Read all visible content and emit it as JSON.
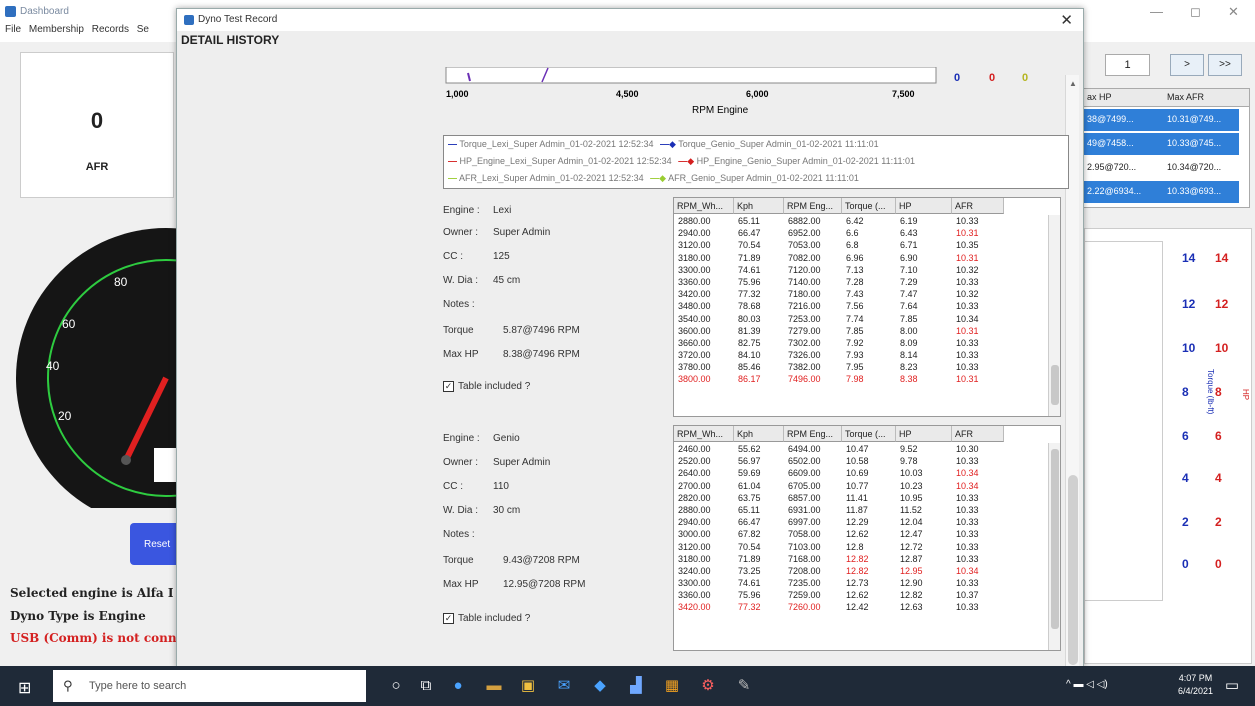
{
  "dashboard": {
    "title": "Dashboard",
    "menu": [
      "File",
      "Membership",
      "Records",
      "Se"
    ],
    "afr_value": "0",
    "afr_label": "AFR",
    "gauge_ticks": [
      "20",
      "40",
      "60",
      "80"
    ],
    "reset_label": "Reset",
    "status_lines": [
      {
        "text": "Selected engine is Alfa I",
        "color": "#1a1a6e"
      },
      {
        "text": "Dyno Type is Engine",
        "color": "#1a1a6e"
      },
      {
        "text": "USB (Comm) is not conn",
        "color": "#d42020"
      }
    ],
    "page_number": "1",
    "next_label": ">",
    "last_label": ">>",
    "max_table": {
      "headers": [
        "ax HP",
        "Max AFR"
      ],
      "rows": [
        {
          "hp": "38@7499...",
          "afr": "10.31@749..."
        },
        {
          "hp": "49@7458...",
          "afr": "10.33@745..."
        },
        {
          "hp": "2.95@720...",
          "afr": "10.34@720..."
        },
        {
          "hp": "2.22@6934...",
          "afr": "10.33@693..."
        }
      ]
    },
    "right_axis_blue": [
      "14",
      "12",
      "10",
      "8",
      "6",
      "4",
      "2",
      "0"
    ],
    "right_axis_red": [
      "14",
      "12",
      "10",
      "8",
      "6",
      "4",
      "2",
      "0"
    ],
    "right_axis_label_blue": "Torque (lb-ft)",
    "right_axis_label_red": "HP"
  },
  "dialog": {
    "title": "Dyno Test Record",
    "heading": "DETAIL HISTORY",
    "close_label": "✕"
  },
  "chart_data": {
    "type": "line",
    "x_ticks": [
      "1,000",
      "4,500",
      "6,000",
      "7,500"
    ],
    "xlabel": "RPM Engine",
    "ylabel": "",
    "readouts": [
      {
        "value": "0",
        "color": "#1a2fb5"
      },
      {
        "value": "0",
        "color": "#d42020"
      },
      {
        "value": "0",
        "color": "#b5b520"
      }
    ],
    "series": [
      {
        "name": "Torque_Lexi_Super Admin_01-02-2021 12:52:34",
        "color": "#1a2fb5"
      },
      {
        "name": "Torque_Genio_Super Admin_01-02-2021 11:11:01",
        "color": "#1a2fb5"
      },
      {
        "name": "HP_Engine_Lexi_Super Admin_01-02-2021 12:52:34",
        "color": "#d42020"
      },
      {
        "name": "HP_Engine_Genio_Super Admin_01-02-2021 11:11:01",
        "color": "#d42020"
      },
      {
        "name": "AFR_Lexi_Super Admin_01-02-2021 12:52:34",
        "color": "#9acd32"
      },
      {
        "name": "AFR_Genio_Super Admin_01-02-2021 11:11:01",
        "color": "#9acd32"
      }
    ]
  },
  "record1": {
    "engine_label": "Engine :",
    "engine": "Lexi",
    "owner_label": "Owner :",
    "owner": "Super Admin",
    "cc_label": "CC :",
    "cc": "125",
    "wdia_label": "W. Dia :",
    "wdia": "45 cm",
    "notes_label": "Notes :",
    "torque_label": "Torque",
    "torque": "5.87@7496 RPM",
    "maxhp_label": "Max HP",
    "maxhp": "8.38@7496 RPM",
    "table_included": "Table included ?",
    "headers": [
      "RPM_Wh...",
      "Kph",
      "RPM Eng...",
      "Torque (...",
      "HP",
      "AFR"
    ],
    "rows": [
      [
        "2880.00",
        "65.11",
        "6882.00",
        "6.42",
        "6.19",
        "10.33"
      ],
      [
        "2940.00",
        "66.47",
        "6952.00",
        "6.6",
        "6.43",
        "10.31"
      ],
      [
        "3120.00",
        "70.54",
        "7053.00",
        "6.8",
        "6.71",
        "10.35"
      ],
      [
        "3180.00",
        "71.89",
        "7082.00",
        "6.96",
        "6.90",
        "10.31"
      ],
      [
        "3300.00",
        "74.61",
        "7120.00",
        "7.13",
        "7.10",
        "10.32"
      ],
      [
        "3360.00",
        "75.96",
        "7140.00",
        "7.28",
        "7.29",
        "10.33"
      ],
      [
        "3420.00",
        "77.32",
        "7180.00",
        "7.43",
        "7.47",
        "10.32"
      ],
      [
        "3480.00",
        "78.68",
        "7216.00",
        "7.56",
        "7.64",
        "10.33"
      ],
      [
        "3540.00",
        "80.03",
        "7253.00",
        "7.74",
        "7.85",
        "10.34"
      ],
      [
        "3600.00",
        "81.39",
        "7279.00",
        "7.85",
        "8.00",
        "10.31"
      ],
      [
        "3660.00",
        "82.75",
        "7302.00",
        "7.92",
        "8.09",
        "10.33"
      ],
      [
        "3720.00",
        "84.10",
        "7326.00",
        "7.93",
        "8.14",
        "10.33"
      ],
      [
        "3780.00",
        "85.46",
        "7382.00",
        "7.95",
        "8.23",
        "10.33"
      ],
      [
        "3800.00",
        "86.17",
        "7496.00",
        "7.98",
        "8.38",
        "10.31"
      ]
    ]
  },
  "record2": {
    "engine_label": "Engine :",
    "engine": "Genio",
    "owner_label": "Owner :",
    "owner": "Super Admin",
    "cc_label": "CC :",
    "cc": "110",
    "wdia_label": "W. Dia :",
    "wdia": "30 cm",
    "notes_label": "Notes :",
    "torque_label": "Torque",
    "torque": "9.43@7208 RPM",
    "maxhp_label": "Max HP",
    "maxhp": "12.95@7208 RPM",
    "table_included": "Table included ?",
    "headers": [
      "RPM_Wh...",
      "Kph",
      "RPM Eng...",
      "Torque (...",
      "HP",
      "AFR"
    ],
    "rows": [
      [
        "2460.00",
        "55.62",
        "6494.00",
        "10.47",
        "9.52",
        "10.30"
      ],
      [
        "2520.00",
        "56.97",
        "6502.00",
        "10.58",
        "9.78",
        "10.33"
      ],
      [
        "2640.00",
        "59.69",
        "6609.00",
        "10.69",
        "10.03",
        "10.34"
      ],
      [
        "2700.00",
        "61.04",
        "6705.00",
        "10.77",
        "10.23",
        "10.34"
      ],
      [
        "2820.00",
        "63.75",
        "6857.00",
        "11.41",
        "10.95",
        "10.33"
      ],
      [
        "2880.00",
        "65.11",
        "6931.00",
        "11.87",
        "11.52",
        "10.33"
      ],
      [
        "2940.00",
        "66.47",
        "6997.00",
        "12.29",
        "12.04",
        "10.33"
      ],
      [
        "3000.00",
        "67.82",
        "7058.00",
        "12.62",
        "12.47",
        "10.33"
      ],
      [
        "3120.00",
        "70.54",
        "7103.00",
        "12.8",
        "12.72",
        "10.33"
      ],
      [
        "3180.00",
        "71.89",
        "7168.00",
        "12.82",
        "12.87",
        "10.33"
      ],
      [
        "3240.00",
        "73.25",
        "7208.00",
        "12.82",
        "12.95",
        "10.34"
      ],
      [
        "3300.00",
        "74.61",
        "7235.00",
        "12.73",
        "12.90",
        "10.33"
      ],
      [
        "3360.00",
        "75.96",
        "7259.00",
        "12.62",
        "12.82",
        "10.37"
      ],
      [
        "3420.00",
        "77.32",
        "7260.00",
        "12.42",
        "12.63",
        "10.33"
      ]
    ]
  },
  "taskbar": {
    "search_placeholder": "Type here to search",
    "time": "4:07 PM",
    "date": "6/4/2021"
  }
}
